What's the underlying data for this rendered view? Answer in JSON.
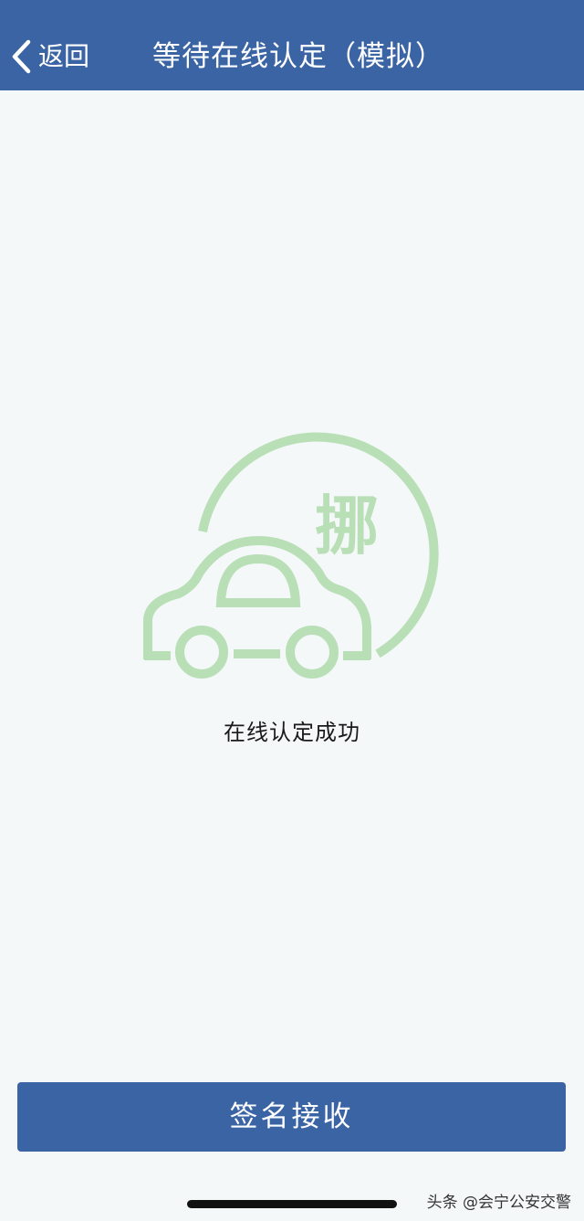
{
  "nav": {
    "back_label": "返回",
    "title": "等待在线认定（模拟）",
    "background": "#3a64a4"
  },
  "illustration": {
    "badge_char": "挪",
    "color": "#b9dfb7",
    "icon": "car-move-icon"
  },
  "status": {
    "message": "在线认定成功"
  },
  "actions": {
    "sign_receive_label": "签名接收"
  },
  "watermark": {
    "text": "头条 @会宁公安交警"
  }
}
